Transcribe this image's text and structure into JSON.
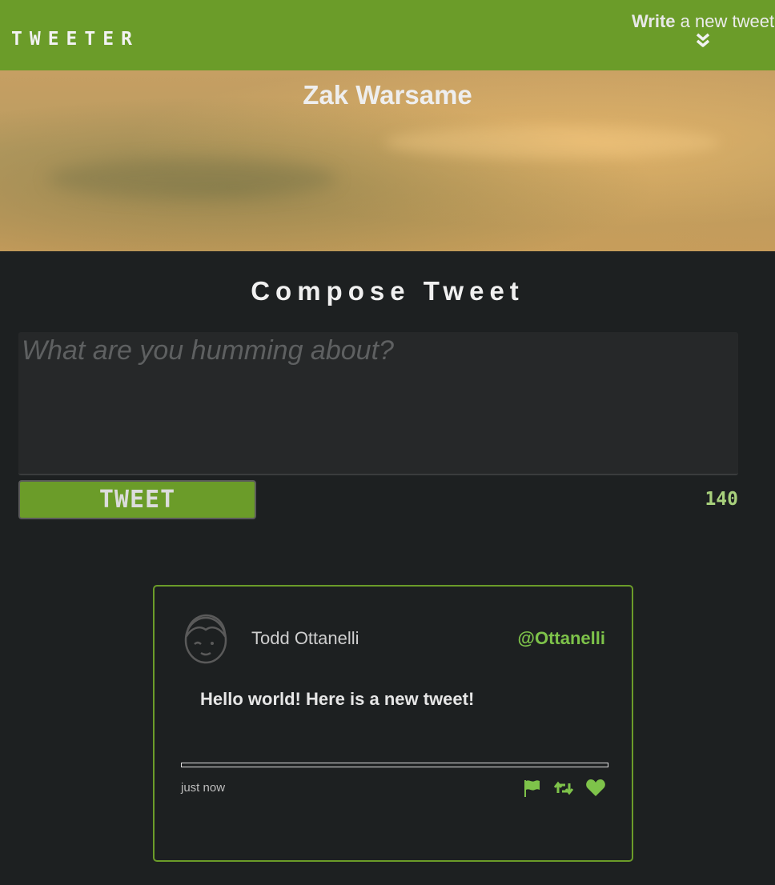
{
  "nav": {
    "brand": "TWEETER",
    "write_bold": "Write",
    "write_rest": " a new tweet",
    "chevron_icon": "double-chevron-down"
  },
  "profile": {
    "name": "Zak Warsame"
  },
  "compose": {
    "title": "Compose Tweet",
    "placeholder": "What are you humming about?",
    "value": "",
    "button_label": "TWEET",
    "counter": "140"
  },
  "tweets": [
    {
      "author": "Todd Ottanelli",
      "handle": "@Ottanelli",
      "text": "Hello world! Here is a new tweet!",
      "timestamp": "just now",
      "icons": [
        "flag-icon",
        "retweet-icon",
        "heart-icon"
      ]
    }
  ],
  "colors": {
    "accent": "#6b9c29",
    "handle": "#7ec34a",
    "background": "#1d2021",
    "counter": "#a8d17c"
  }
}
